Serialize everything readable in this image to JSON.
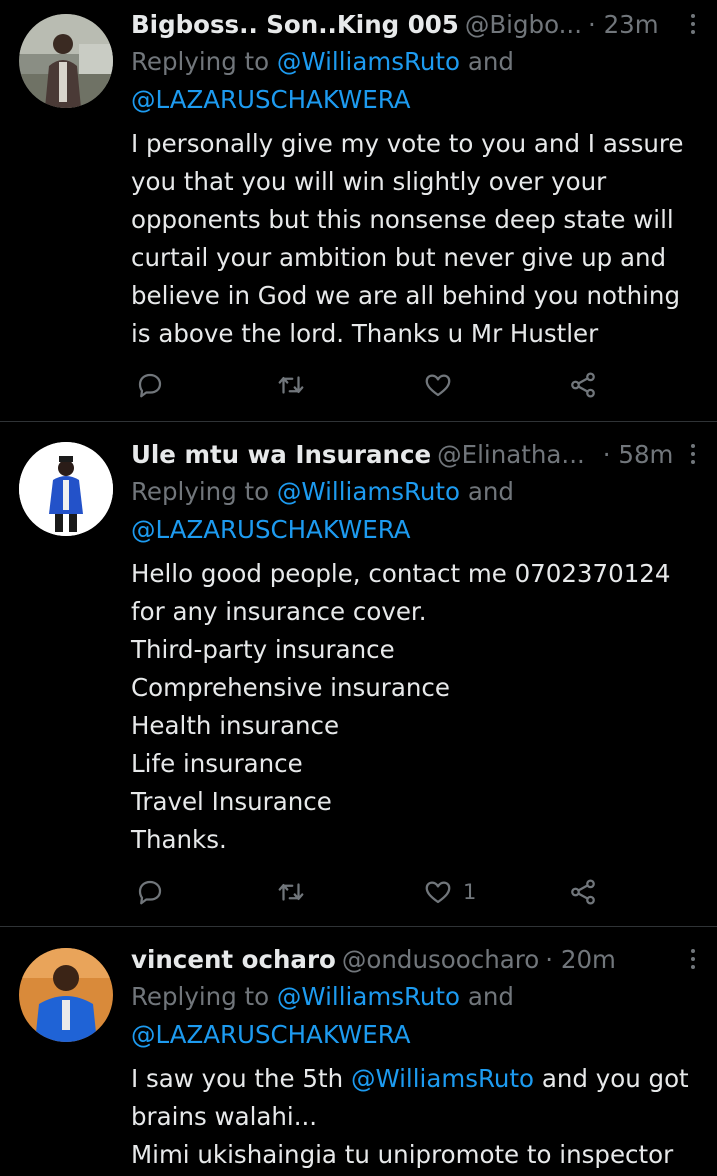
{
  "tweets": [
    {
      "name": "Bigboss.. Son..King 005",
      "handle": "@Bigbo...",
      "time": "· 23m",
      "reply_prefix": "Replying to ",
      "reply_first": "@WilliamsRuto",
      "reply_and": " and",
      "reply_second": "@LAZARUSCHAKWERA",
      "text": "I personally give my vote to you and I assure you that you will win slightly over your opponents but this nonsense deep state will curtail your ambition but never give up and believe in God we are all behind you nothing is above the lord. Thanks u Mr Hustler",
      "likes": ""
    },
    {
      "name": "Ule mtu wa Insurance",
      "handle": "@Elinatha...",
      "time": "· 58m",
      "reply_prefix": "Replying to ",
      "reply_first": "@WilliamsRuto",
      "reply_and": " and",
      "reply_second": "@LAZARUSCHAKWERA",
      "lines": [
        "Hello good people, contact me 0702370124",
        "for any insurance cover.",
        "Third-party insurance",
        "Comprehensive insurance",
        "Health insurance",
        "Life insurance",
        "Travel Insurance",
        "Thanks."
      ],
      "likes": "1"
    },
    {
      "name": "vincent ocharo",
      "handle": "@ondusoocharo",
      "time": "· 20m",
      "reply_prefix": "Replying to ",
      "reply_first": "@WilliamsRuto",
      "reply_and": " and",
      "reply_second": "@LAZARUSCHAKWERA",
      "text_before": "I saw you the 5th ",
      "text_mention": "@WilliamsRuto",
      "text_after": " and you got",
      "line2": "brains walahi...",
      "line3": "Mimi ukishaingia tu unipromote to inspector"
    }
  ],
  "icons": [
    "reply-icon",
    "retweet-icon",
    "like-icon",
    "share-icon",
    "more-icon"
  ],
  "colors": {
    "background": "#000000",
    "text": "#e7e9ea",
    "muted": "#71767b",
    "link": "#1d9bf0",
    "divider": "#2f3336"
  }
}
